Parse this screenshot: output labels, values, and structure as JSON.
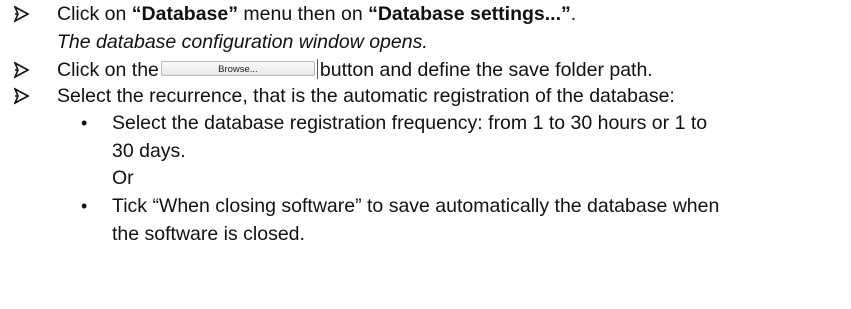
{
  "steps": [
    {
      "pre": "Click on ",
      "bold1": "“Database”",
      "mid": " menu then on ",
      "bold2": "“Database settings...”",
      "post": ".",
      "note": "The database configuration window opens."
    },
    {
      "pre": "Click on the",
      "button_label": "Browse...",
      "post": "button and define the save folder path."
    },
    {
      "text": "Select the recurrence, that is the automatic registration of the database:"
    }
  ],
  "sub_items": [
    {
      "bullet": "•",
      "line1": "Select the database registration frequency: from 1 to 30 hours or 1 to",
      "line2": "30 days.",
      "or": "Or"
    },
    {
      "bullet": "•",
      "line1": "Tick “When closing software” to save automatically the database when",
      "line2": "the software is closed."
    }
  ],
  "icons": {
    "step_marker": "arrowhead-bullet-icon"
  }
}
